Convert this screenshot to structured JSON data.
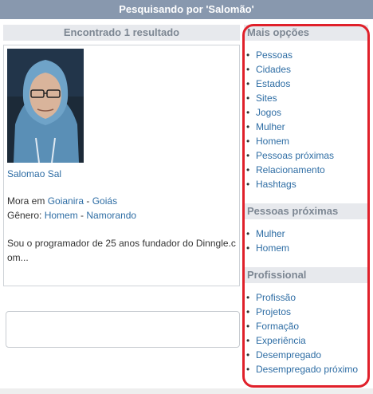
{
  "header": {
    "title": "Pesquisando por 'Salomão'"
  },
  "results": {
    "count_label": "Encontrado 1 resultado",
    "items": [
      {
        "name": "Salomao Sal",
        "lives_prefix": "Mora em ",
        "city": "Goianira",
        "separator": " - ",
        "state": "Goiás",
        "gender_prefix": "Gênero: ",
        "gender": "Homem",
        "status": "Namorando",
        "bio": "Sou o programador de 25 anos fundador do Dinngle.com..."
      }
    ]
  },
  "sidebar": {
    "sections": [
      {
        "title": "Mais opções",
        "items": [
          "Pessoas",
          "Cidades",
          "Estados",
          "Sites",
          "Jogos",
          "Mulher",
          "Homem",
          "Pessoas próximas",
          "Relacionamento",
          "Hashtags"
        ]
      },
      {
        "title": "Pessoas próximas",
        "items": [
          "Mulher",
          "Homem"
        ]
      },
      {
        "title": "Profissional",
        "items": [
          "Profissão",
          "Projetos",
          "Formação",
          "Experiência",
          "Desempregado",
          "Desempregado próximo"
        ]
      }
    ]
  },
  "colors": {
    "header_bg": "#8898ae",
    "link": "#2e6da4",
    "highlight": "#e0202a",
    "section_bg": "#e7e9ed"
  }
}
